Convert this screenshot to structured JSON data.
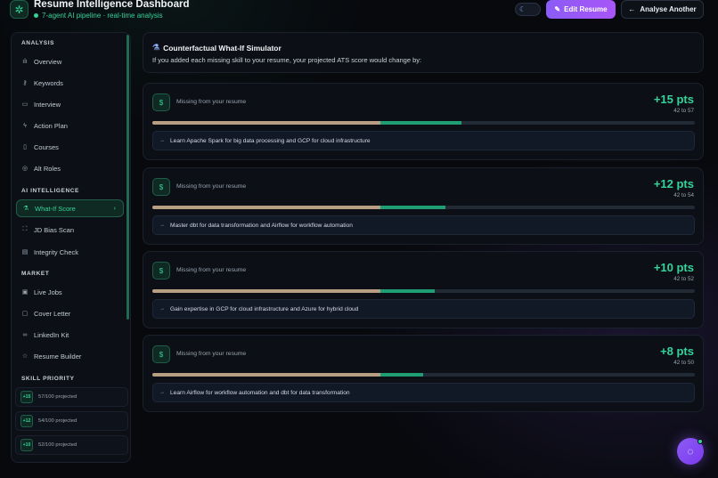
{
  "header": {
    "title": "Resume Intelligence Dashboard",
    "subtitle": "7-agent AI pipeline · real-time analysis",
    "edit_label": "Edit Resume",
    "analyse_label": "Analyse Another"
  },
  "sidebar": {
    "sections": {
      "analysis": "ANALYSIS",
      "ai": "AI INTELLIGENCE",
      "market": "MARKET",
      "skills": "SKILL PRIORITY"
    },
    "items": [
      {
        "label": "Overview",
        "icon": "bar-chart-icon"
      },
      {
        "label": "Keywords",
        "icon": "key-icon"
      },
      {
        "label": "Interview",
        "icon": "chat-icon"
      },
      {
        "label": "Action Plan",
        "icon": "bolt-icon"
      },
      {
        "label": "Courses",
        "icon": "book-icon"
      },
      {
        "label": "Alt Roles",
        "icon": "target-icon"
      },
      {
        "label": "What-If Score",
        "icon": "flask-icon",
        "active": true
      },
      {
        "label": "JD Bias Scan",
        "icon": "scan-icon"
      },
      {
        "label": "Integrity Check",
        "icon": "document-icon"
      },
      {
        "label": "Live Jobs",
        "icon": "briefcase-icon"
      },
      {
        "label": "Cover Letter",
        "icon": "file-icon"
      },
      {
        "label": "LinkedIn Kit",
        "icon": "link-icon"
      },
      {
        "label": "Resume Builder",
        "icon": "star-icon"
      }
    ],
    "skills": [
      {
        "badge": "+15",
        "text": "57/100 projected"
      },
      {
        "badge": "+12",
        "text": "54/100 projected"
      },
      {
        "badge": "+10",
        "text": "52/100 projected"
      }
    ]
  },
  "simulator": {
    "title": "Counterfactual What-If Simulator",
    "description": "If you added each missing skill to your resume, your projected ATS score would change by:"
  },
  "cards": [
    {
      "missing": "Missing from your resume",
      "pts": "+15 pts",
      "range": "42 to 57",
      "base": 42,
      "projected": 57,
      "rec": "Learn Apache Spark for big data processing and GCP for cloud infrastructure"
    },
    {
      "missing": "Missing from your resume",
      "pts": "+12 pts",
      "range": "42 to 54",
      "base": 42,
      "projected": 54,
      "rec": "Master dbt for data transformation and Airflow for workflow automation"
    },
    {
      "missing": "Missing from your resume",
      "pts": "+10 pts",
      "range": "42 to 52",
      "base": 42,
      "projected": 52,
      "rec": "Gain expertise in GCP for cloud infrastructure and Azure for hybrid cloud"
    },
    {
      "missing": "Missing from your resume",
      "pts": "+8 pts",
      "range": "42 to 50",
      "base": 42,
      "projected": 50,
      "rec": "Learn Airflow for workflow automation and dbt for data transformation"
    }
  ],
  "colors": {
    "accent": "#34d399",
    "primary_button": "#8b5cf6",
    "bar_base": "#b89f83",
    "bar_gain": "#1f9e73"
  }
}
